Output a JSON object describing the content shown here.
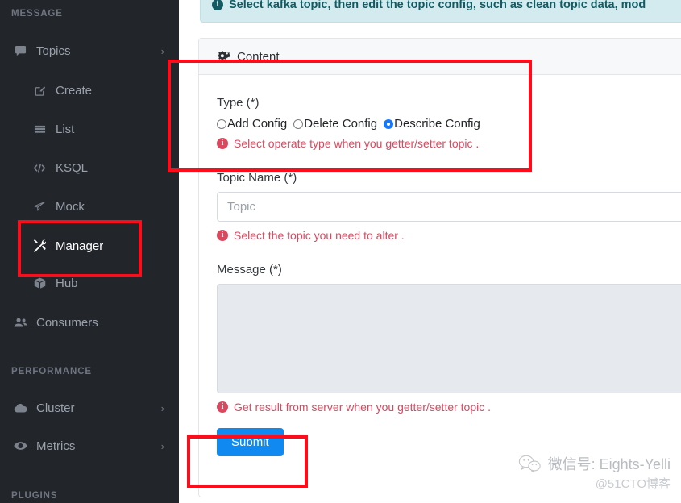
{
  "sidebar": {
    "sections": [
      {
        "title": "MESSAGE"
      },
      {
        "title": "PERFORMANCE"
      },
      {
        "title": "PLUGINS"
      }
    ],
    "items": [
      {
        "label": "Topics",
        "icon": "comment-icon",
        "level": 1,
        "chevron": "›",
        "active": false
      },
      {
        "label": "Create",
        "icon": "edit-square-icon",
        "level": 2,
        "chevron": "",
        "active": false
      },
      {
        "label": "List",
        "icon": "table-icon",
        "level": 2,
        "chevron": "",
        "active": false
      },
      {
        "label": "KSQL",
        "icon": "code-icon",
        "level": 2,
        "chevron": "",
        "active": false
      },
      {
        "label": "Mock",
        "icon": "paper-plane-icon",
        "level": 2,
        "chevron": "",
        "active": false
      },
      {
        "label": "Manager",
        "icon": "tools-icon",
        "level": 2,
        "chevron": "",
        "active": true
      },
      {
        "label": "Hub",
        "icon": "cube-icon",
        "level": 2,
        "chevron": "",
        "active": false
      },
      {
        "label": "Consumers",
        "icon": "users-icon",
        "level": 1,
        "chevron": "",
        "active": false
      },
      {
        "label": "Cluster",
        "icon": "cloud-icon",
        "level": 1,
        "chevron": "›",
        "active": false
      },
      {
        "label": "Metrics",
        "icon": "eye-icon",
        "level": 1,
        "chevron": "›",
        "active": false
      }
    ]
  },
  "alert": {
    "text": "Select kafka topic, then edit the topic config, such as clean topic data, mod"
  },
  "card": {
    "header_label": "Content",
    "header_icon": "gears-icon",
    "type_field": {
      "label": "Type (*)",
      "options": [
        {
          "label": "Add Config",
          "selected": false
        },
        {
          "label": "Delete Config",
          "selected": false
        },
        {
          "label": "Describe Config",
          "selected": true
        }
      ],
      "hint": "Select operate type when you getter/setter topic ."
    },
    "topic_field": {
      "label": "Topic Name (*)",
      "placeholder": "Topic",
      "value": "",
      "hint": "Select the topic you need to alter ."
    },
    "message_field": {
      "label": "Message (*)",
      "placeholder": "",
      "value": "",
      "hint": "Get result from server when you getter/setter topic ."
    },
    "submit_label": "Submit"
  },
  "watermark": {
    "wechat_line": "微信号: Eights-Yelli",
    "site_line": "@51CTO博客"
  },
  "colors": {
    "sidebar_bg": "#22252a",
    "accent_blue": "#1089f0",
    "hint_red": "#d9485f",
    "alert_bg": "#d3eaef",
    "alert_text": "#115b63",
    "annotation_red": "#fc0d1b",
    "radio_selected": "#1479ff",
    "textarea_bg": "#e6eaee"
  }
}
